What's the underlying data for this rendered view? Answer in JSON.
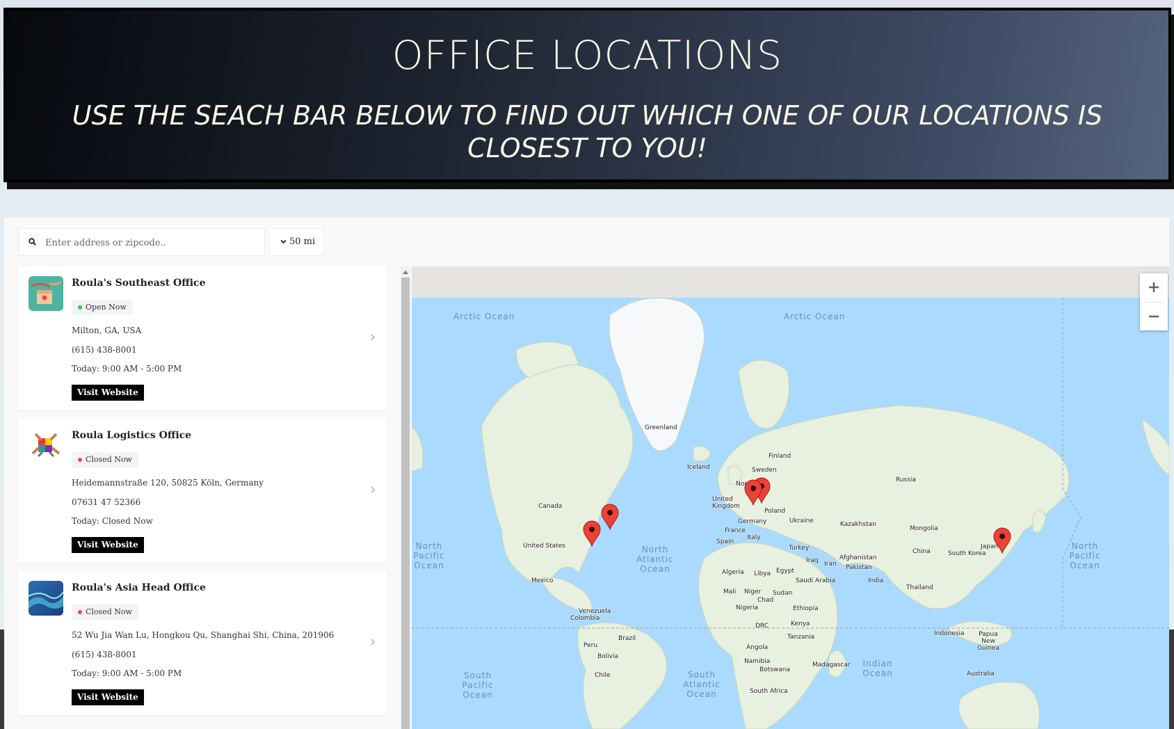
{
  "header": {
    "title": "OFFICE LOCATIONS",
    "subtitle": "USE THE SEACH BAR BELOW TO FIND OUT WHICH ONE OF OUR LOCATIONS IS CLOSEST TO YOU!"
  },
  "search": {
    "placeholder": "Enter address or zipcode..",
    "radius": "50 mi"
  },
  "locations": [
    {
      "name": "Roula's Southeast Office",
      "status": "Open Now",
      "status_color": "#2ecc40",
      "address": "Milton, GA, USA",
      "phone": "(615) 438-8001",
      "hours": "Today: 9:00 AM - 5:00 PM",
      "button": "Visit Website",
      "logo_icon": "gift-box-illustration"
    },
    {
      "name": "Roula Logistics Office",
      "status": "Closed Now",
      "status_color": "#e8457a",
      "address": "Heidemannstraße 120, 50825 Köln, Germany",
      "phone": "07631 47 52366",
      "hours": "Today: Closed Now",
      "button": "Visit Website",
      "logo_icon": "puzzle-hands-illustration"
    },
    {
      "name": "Roula's Asia Head Office",
      "status": "Closed Now",
      "status_color": "#e8457a",
      "address": "52 Wu Jia Wan Lu, Hongkou Qu, Shanghai Shi, China, 201906",
      "phone": "(615) 438-8001",
      "hours": "Today: 9:00 AM - 5:00 PM",
      "button": "Visit Website",
      "logo_icon": "blue-abstract-illustration"
    }
  ],
  "map": {
    "zoom_in": "+",
    "zoom_out": "−",
    "oceans": [
      "Arctic Ocean",
      "Arctic Ocean",
      "North Pacific Ocean",
      "North Atlantic Ocean",
      "North Pacific Ocean",
      "South Pacific Ocean",
      "South Atlantic Ocean",
      "Indian Ocean"
    ],
    "labels": [
      "Greenland",
      "Iceland",
      "Finland",
      "Sweden",
      "Norway",
      "Russia",
      "Canada",
      "United Kingdom",
      "Poland",
      "Germany",
      "Ukraine",
      "France",
      "Kazakhstan",
      "Mongolia",
      "Spain",
      "Italy",
      "United States",
      "Turkey",
      "China",
      "Japan",
      "South Korea",
      "Iraq",
      "Iran",
      "Afghanistan",
      "Pakistan",
      "Algeria",
      "Libya",
      "Egypt",
      "Saudi Arabia",
      "Mexico",
      "India",
      "Mali",
      "Niger",
      "Sudan",
      "Chad",
      "Thailand",
      "Nigeria",
      "Ethiopia",
      "Venezuela",
      "Colombia",
      "DRC",
      "Kenya",
      "Indonesia",
      "Papua New Guinea",
      "Tanzania",
      "Brazil",
      "Peru",
      "Bolivia",
      "Angola",
      "Namibia",
      "Botswana",
      "Madagascar",
      "Chile",
      "Australia",
      "South Africa"
    ],
    "pin_color": "#ea4335"
  }
}
